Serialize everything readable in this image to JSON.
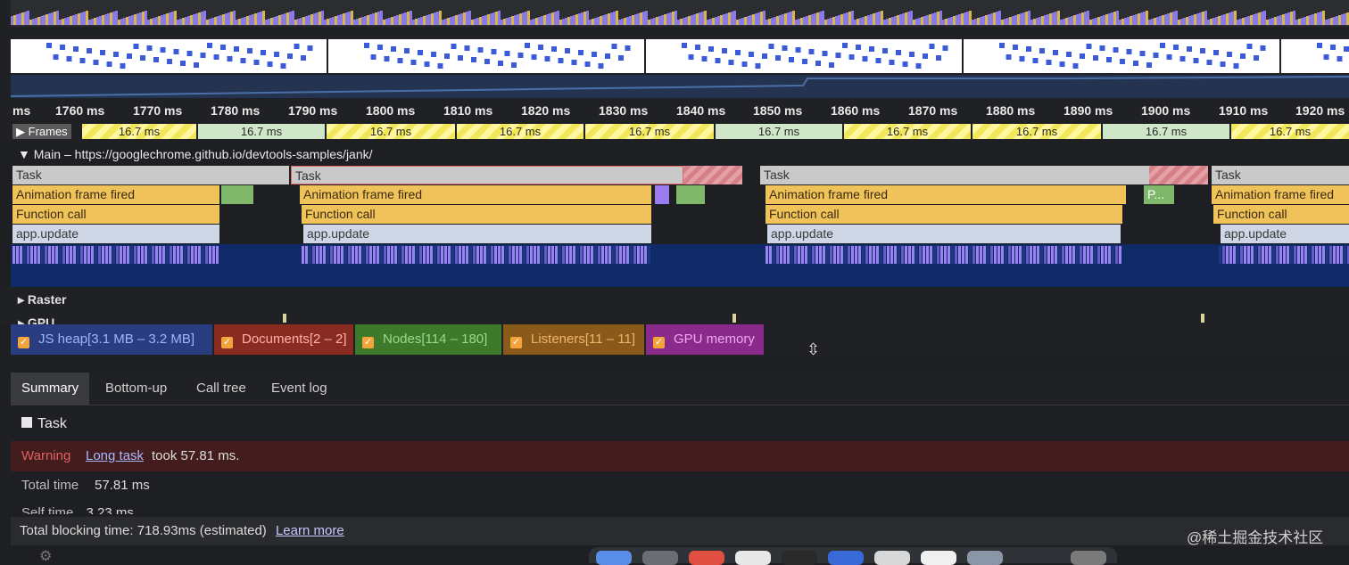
{
  "ruler": {
    "ticks": [
      "ms",
      "1760 ms",
      "1770 ms",
      "1780 ms",
      "1790 ms",
      "1800 ms",
      "1810 ms",
      "1820 ms",
      "1830 ms",
      "1840 ms",
      "1850 ms",
      "1860 ms",
      "1870 ms",
      "1880 ms",
      "1890 ms",
      "1900 ms",
      "1910 ms",
      "1920 ms"
    ]
  },
  "frames": {
    "label": "Frames",
    "items": [
      {
        "label": "16.7 ms",
        "style": "y"
      },
      {
        "label": "16.7 ms",
        "style": "g"
      },
      {
        "label": "16.7 ms",
        "style": "y"
      },
      {
        "label": "16.7 ms",
        "style": "y"
      },
      {
        "label": "16.7 ms",
        "style": "y"
      },
      {
        "label": "16.7 ms",
        "style": "g"
      },
      {
        "label": "16.7 ms",
        "style": "y"
      },
      {
        "label": "16.7 ms",
        "style": "y"
      },
      {
        "label": "16.7 ms",
        "style": "g"
      },
      {
        "label": "16.7 ms",
        "style": "y"
      }
    ]
  },
  "main": {
    "header": "Main – https://googlechrome.github.io/devtools-samples/jank/",
    "task_label": "Task",
    "anim_label": "Animation frame fired",
    "func_label": "Function call",
    "update_label": "app.update",
    "partial_label": "P..."
  },
  "tracks": {
    "raster": "Raster",
    "gpu": "GPU"
  },
  "counters": [
    {
      "label": "JS heap[3.1 MB – 3.2 MB]",
      "color": "#2a3d80",
      "text": "#9fb4ff"
    },
    {
      "label": "Documents[2 – 2]",
      "color": "#8a2b22",
      "text": "#ffb2a8"
    },
    {
      "label": "Nodes[114 – 180]",
      "color": "#3d7a2b",
      "text": "#9fd68a"
    },
    {
      "label": "Listeners[11 – 11]",
      "color": "#8a5a1a",
      "text": "#f0b36a"
    },
    {
      "label": "GPU memory",
      "color": "#8a2a8a",
      "text": "#f0a8f0"
    }
  ],
  "tabs": [
    "Summary",
    "Bottom-up",
    "Call tree",
    "Event log"
  ],
  "summary": {
    "title": "Task",
    "warning_label": "Warning",
    "warning_link": "Long task",
    "warning_text": "took 57.81 ms.",
    "total_time_label": "Total time",
    "total_time_value": "57.81 ms",
    "self_time_label": "Self time",
    "self_time_value": "3.23 ms"
  },
  "footer": {
    "text": "Total blocking time: 718.93ms (estimated)",
    "link": "Learn more"
  },
  "watermark": "@稀土掘金技术社区"
}
